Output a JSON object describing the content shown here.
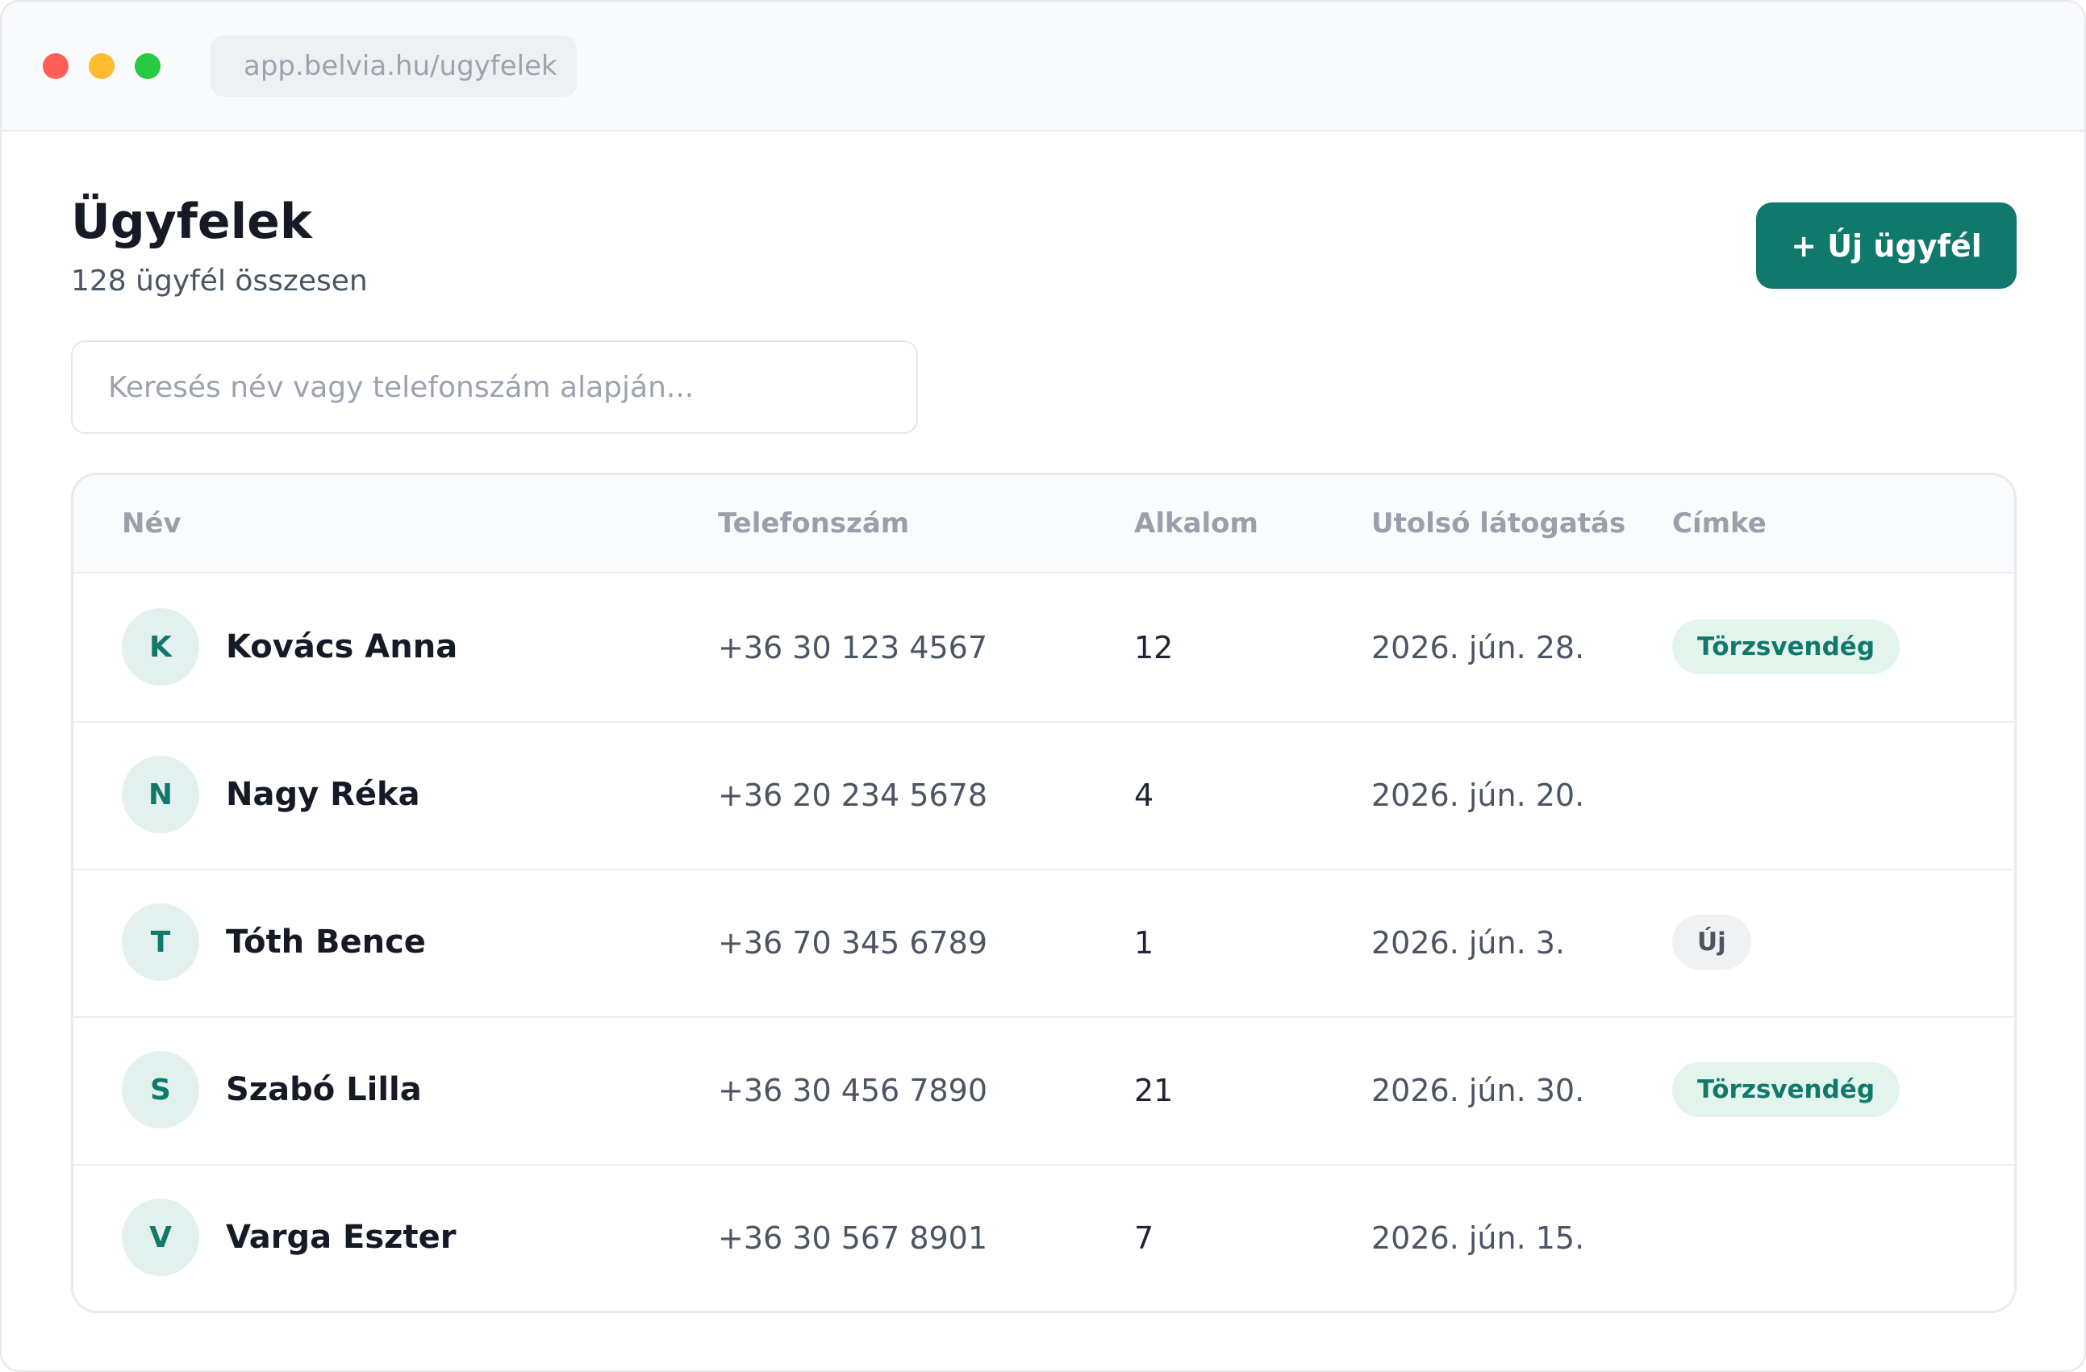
{
  "browser": {
    "url": "app.belvia.hu/ugyfelek"
  },
  "header": {
    "title": "Ügyfelek",
    "subtitle": "128 ügyfél összesen",
    "new_button_label": "+ Új ügyfél"
  },
  "search": {
    "placeholder": "Keresés név vagy telefonszám alapján...",
    "value": ""
  },
  "table": {
    "columns": {
      "name": "Név",
      "phone": "Telefonszám",
      "visits": "Alkalom",
      "last_visit": "Utolsó látogatás",
      "tag": "Címke"
    },
    "rows": [
      {
        "initial": "K",
        "name": "Kovács Anna",
        "phone": "+36 30 123 4567",
        "visits": "12",
        "last_visit": "2026. jún. 28.",
        "tag": "Törzsvendég",
        "tag_type": "regular"
      },
      {
        "initial": "N",
        "name": "Nagy Réka",
        "phone": "+36 20 234 5678",
        "visits": "4",
        "last_visit": "2026. jún. 20.",
        "tag": "",
        "tag_type": ""
      },
      {
        "initial": "T",
        "name": "Tóth Bence",
        "phone": "+36 70 345 6789",
        "visits": "1",
        "last_visit": "2026. jún. 3.",
        "tag": "Új",
        "tag_type": "new"
      },
      {
        "initial": "S",
        "name": "Szabó Lilla",
        "phone": "+36 30 456 7890",
        "visits": "21",
        "last_visit": "2026. jún. 30.",
        "tag": "Törzsvendég",
        "tag_type": "regular"
      },
      {
        "initial": "V",
        "name": "Varga Eszter",
        "phone": "+36 30 567 8901",
        "visits": "7",
        "last_visit": "2026. jún. 15.",
        "tag": "",
        "tag_type": ""
      }
    ]
  },
  "colors": {
    "accent": "#10796b",
    "avatar_bg": "#e3f1ee",
    "tag_regular_bg": "#e3f4ec",
    "tag_new_bg": "#f0f1f3"
  }
}
